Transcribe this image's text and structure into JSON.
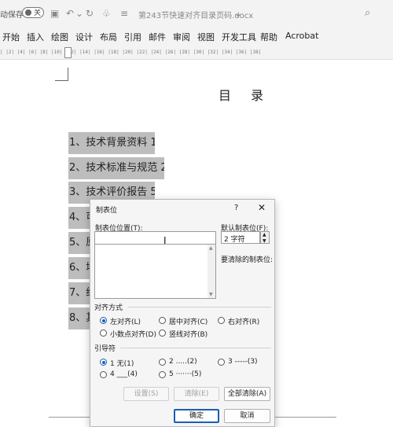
{
  "qat": {
    "autosave_label": "动保存",
    "autosave_state": "关",
    "doc_title": "第243节快速对齐目录页码.docx",
    "icons": [
      "save-icon",
      "undo-icon",
      "redo-icon",
      "format-painter-icon",
      "customize-icon",
      "search-icon"
    ]
  },
  "menu": {
    "items": [
      "开始",
      "插入",
      "绘图",
      "设计",
      "布局",
      "引用",
      "邮件",
      "审阅",
      "视图",
      "开发工具",
      "帮助",
      "Acrobat"
    ]
  },
  "ruler": {
    "scale": "|  |2|  |4|  |6|  |8|  |10|  |12|  |14|  |16|  |18|  |20|  |22|  |24|  |26|  |28|  |30|  |32|  |34|  |36|  |38|"
  },
  "document": {
    "title": "目 录",
    "toc": [
      "1、技术背景资料 1",
      "2、技术标准与规范 2",
      "3、技术评价报告 5",
      "4、可",
      "5、原",
      "6、培",
      "7、结",
      "8、其"
    ]
  },
  "dialog": {
    "title": "制表位",
    "help": "?",
    "close": "✕",
    "tab_position_label": "制表位位置(T):",
    "tab_position_value": "",
    "default_tab_label": "默认制表位(F):",
    "default_tab_value": "2 字符",
    "to_clear_label": "要清除的制表位:",
    "alignment": {
      "label": "对齐方式",
      "options": [
        "左对齐(L)",
        "居中对齐(C)",
        "右对齐(R)",
        "小数点对齐(D)",
        "竖线对齐(B)"
      ],
      "selected": "左对齐(L)"
    },
    "leader": {
      "label": "引导符",
      "options": [
        "1 无(1)",
        "2 .....(2)",
        "3 -----(3)",
        "4 ___(4)",
        "5 ·······(5)"
      ],
      "selected": "1 无(1)"
    },
    "buttons": {
      "set": "设置(S)",
      "clear": "清除(E)",
      "clear_all": "全部清除(A)",
      "ok": "确定",
      "cancel": "取消"
    }
  }
}
